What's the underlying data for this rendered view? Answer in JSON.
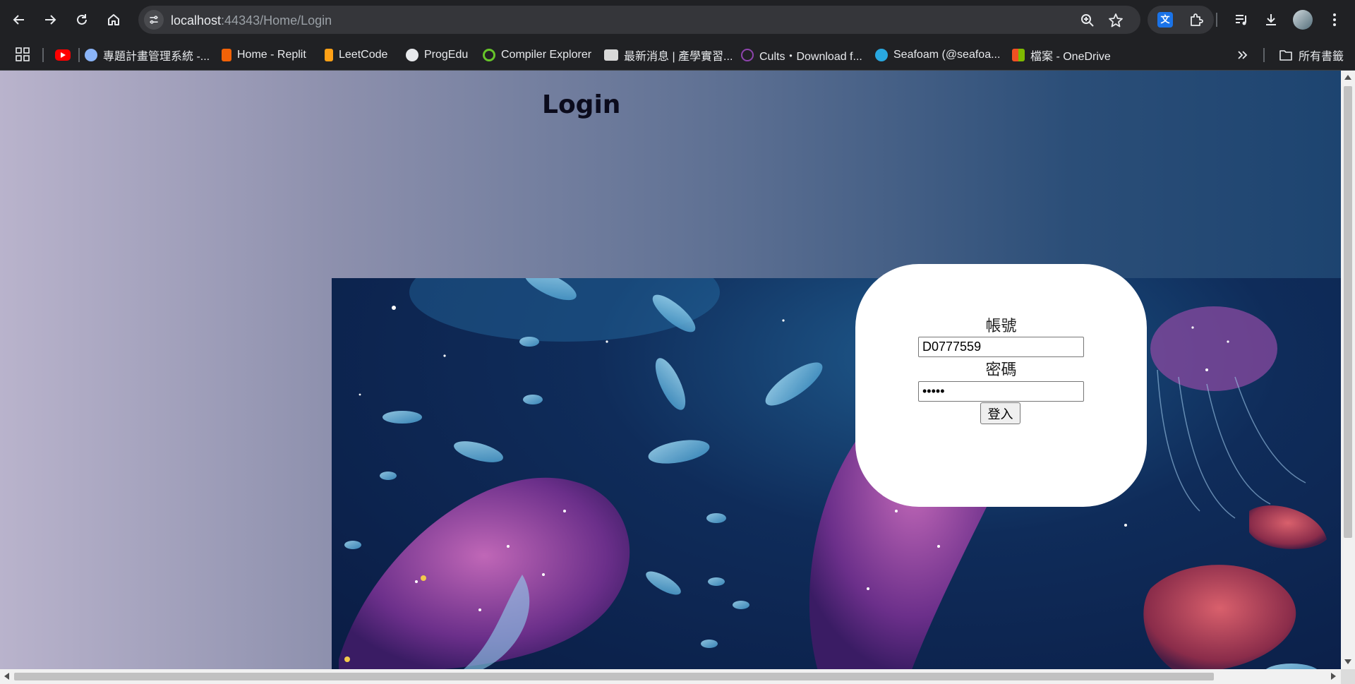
{
  "browser": {
    "url_host": "localhost",
    "url_path": ":44343/Home/Login",
    "bookmarks": [
      {
        "label": "",
        "icon": "youtube-icon",
        "color": "#ff0000"
      },
      {
        "label": "專題計畫管理系統 -...",
        "icon": "globe-icon",
        "color": "#8ab4f8"
      },
      {
        "label": "Home - Replit",
        "icon": "replit-icon",
        "color": "#f26207"
      },
      {
        "label": "LeetCode",
        "icon": "leetcode-icon",
        "color": "#ffa116"
      },
      {
        "label": "ProgEdu",
        "icon": "progedu-icon",
        "color": "#e8eaed"
      },
      {
        "label": "Compiler Explorer",
        "icon": "compiler-explorer-icon",
        "color": "#67c52a"
      },
      {
        "label": "最新消息 | 產學實習...",
        "icon": "iecs-icon",
        "color": "#d9d9d9"
      },
      {
        "label": "Cults・Download f...",
        "icon": "cults-icon",
        "color": "#8e44ad"
      },
      {
        "label": "Seafoam (@seafoa...",
        "icon": "seafoam-icon",
        "color": "#29a8e0"
      },
      {
        "label": "檔案 - OneDrive",
        "icon": "microsoft-icon",
        "color": "#f25022"
      }
    ],
    "all_bookmarks_label": "所有書籤"
  },
  "page": {
    "title": "Login",
    "account_label": "帳號",
    "account_value": "D0777559",
    "password_label": "密碼",
    "password_value": "•••••",
    "login_button": "登入"
  },
  "colors": {
    "chrome_bg": "#202124",
    "omnibox_bg": "#35363a",
    "gradient_left": "#b9b3cc",
    "gradient_right": "#1d4470",
    "ocean_dark": "#0a1c44"
  }
}
